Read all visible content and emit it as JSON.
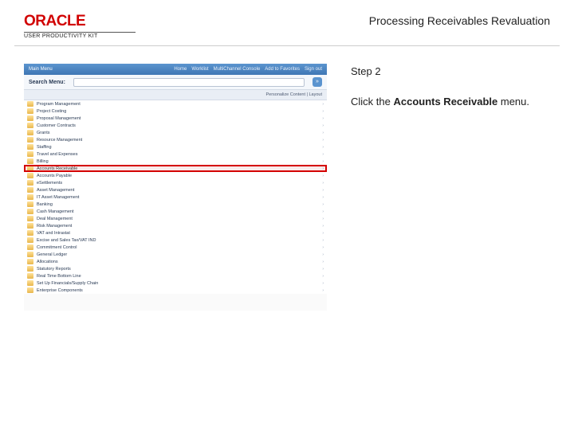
{
  "brand": {
    "name": "ORACLE",
    "subtitle": "USER PRODUCTIVITY KIT"
  },
  "title": "Processing Receivables Revaluation",
  "step_label": "Step 2",
  "instruction_prefix": "Click the ",
  "instruction_bold": "Accounts Receivable",
  "instruction_suffix": " menu.",
  "app": {
    "topbar_left": "Main Menu",
    "topbar_links": [
      "Home",
      "Worklist",
      "MultiChannel Console",
      "Add to Favorites",
      "Sign out"
    ],
    "search_label": "Search Menu:",
    "search_go": "»",
    "content_band": "Personalize Content | Layout",
    "menu": [
      "Program Management",
      "Project Costing",
      "Proposal Management",
      "Customer Contracts",
      "Grants",
      "Resource Management",
      "Staffing",
      "Travel and Expenses",
      "Billing",
      "Accounts Receivable",
      "Accounts Payable",
      "eSettlements",
      "Asset Management",
      "IT Asset Management",
      "Banking",
      "Cash Management",
      "Deal Management",
      "Risk Management",
      "VAT and Intrastat",
      "Excise and Sales Tax/VAT IND",
      "Commitment Control",
      "General Ledger",
      "Allocations",
      "Statutory Reports",
      "Real Time Bottom Line",
      "Set Up Financials/Supply Chain",
      "Enterprise Components"
    ],
    "highlight_index": 9
  }
}
